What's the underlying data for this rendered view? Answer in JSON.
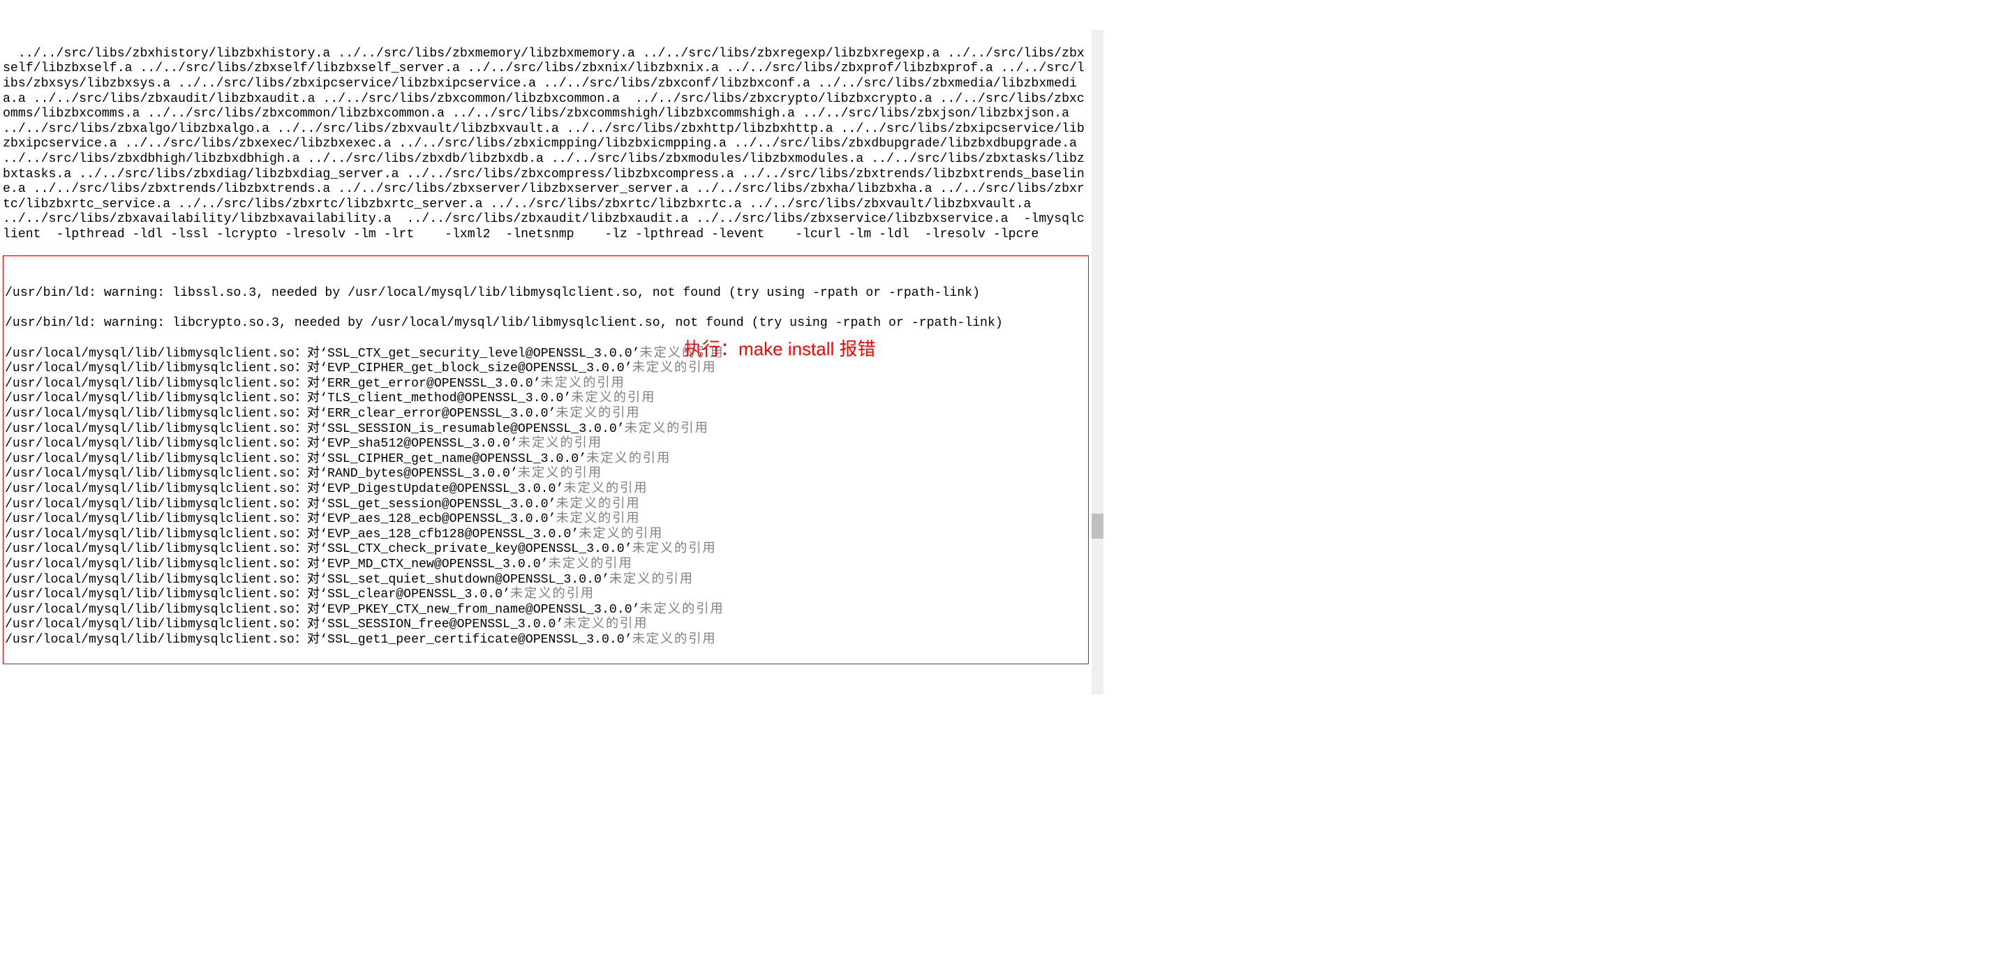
{
  "top": "  ../../src/libs/zbxhistory/libzbxhistory.a ../../src/libs/zbxmemory/libzbxmemory.a ../../src/libs/zbxregexp/libzbxregexp.a ../../src/libs/zbxself/libzbxself.a ../../src/libs/zbxself/libzbxself_server.a ../../src/libs/zbxnix/libzbxnix.a ../../src/libs/zbxprof/libzbxprof.a ../../src/libs/zbxsys/libzbxsys.a ../../src/libs/zbxipcservice/libzbxipcservice.a ../../src/libs/zbxconf/libzbxconf.a ../../src/libs/zbxmedia/libzbxmedia.a ../../src/libs/zbxaudit/libzbxaudit.a ../../src/libs/zbxcommon/libzbxcommon.a  ../../src/libs/zbxcrypto/libzbxcrypto.a ../../src/libs/zbxcomms/libzbxcomms.a ../../src/libs/zbxcommon/libzbxcommon.a ../../src/libs/zbxcommshigh/libzbxcommshigh.a ../../src/libs/zbxjson/libzbxjson.a ../../src/libs/zbxalgo/libzbxalgo.a ../../src/libs/zbxvault/libzbxvault.a ../../src/libs/zbxhttp/libzbxhttp.a ../../src/libs/zbxipcservice/libzbxipcservice.a ../../src/libs/zbxexec/libzbxexec.a ../../src/libs/zbxicmpping/libzbxicmpping.a ../../src/libs/zbxdbupgrade/libzbxdbupgrade.a ../../src/libs/zbxdbhigh/libzbxdbhigh.a ../../src/libs/zbxdb/libzbxdb.a ../../src/libs/zbxmodules/libzbxmodules.a ../../src/libs/zbxtasks/libzbxtasks.a ../../src/libs/zbxdiag/libzbxdiag_server.a ../../src/libs/zbxcompress/libzbxcompress.a ../../src/libs/zbxtrends/libzbxtrends_baseline.a ../../src/libs/zbxtrends/libzbxtrends.a ../../src/libs/zbxserver/libzbxserver_server.a ../../src/libs/zbxha/libzbxha.a ../../src/libs/zbxrtc/libzbxrtc_service.a ../../src/libs/zbxrtc/libzbxrtc_server.a ../../src/libs/zbxrtc/libzbxrtc.a ../../src/libs/zbxvault/libzbxvault.a  ../../src/libs/zbxavailability/libzbxavailability.a  ../../src/libs/zbxaudit/libzbxaudit.a ../../src/libs/zbxservice/libzbxservice.a  -lmysqlclient  -lpthread -ldl -lssl -lcrypto -lresolv -lm -lrt    -lxml2  -lnetsnmp    -lz -lpthread -levent    -lcurl -lm -ldl  -lresolv -lpcre ",
  "warn1": "/usr/bin/ld: warning: libssl.so.3, needed by /usr/local/mysql/lib/libmysqlclient.so, not found (try using -rpath or -rpath-link)",
  "warn2": "/usr/bin/ld: warning: libcrypto.so.3, needed by /usr/local/mysql/lib/libmysqlclient.so, not found (try using -rpath or -rpath-link)",
  "prefix": "/usr/local/mysql/lib/libmysqlclient.so：对‘",
  "mid": "@OPENSSL_3.0.0’",
  "suffix": "未定义的引用",
  "errors": [
    "SSL_CTX_get_security_level",
    "EVP_CIPHER_get_block_size",
    "ERR_get_error",
    "TLS_client_method",
    "ERR_clear_error",
    "SSL_SESSION_is_resumable",
    "EVP_sha512",
    "SSL_CIPHER_get_name",
    "RAND_bytes",
    "EVP_DigestUpdate",
    "SSL_get_session",
    "EVP_aes_128_ecb",
    "EVP_aes_128_cfb128",
    "SSL_CTX_check_private_key",
    "EVP_MD_CTX_new",
    "SSL_set_quiet_shutdown",
    "SSL_clear",
    "EVP_PKEY_CTX_new_from_name",
    "SSL_SESSION_free",
    "SSL_get1_peer_certificate"
  ],
  "annotation": "执行：make install 报错"
}
